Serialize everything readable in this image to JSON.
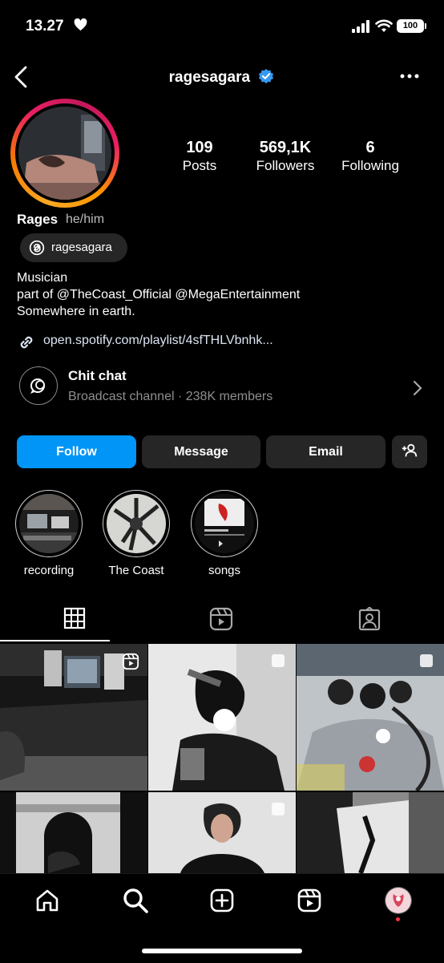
{
  "status_bar": {
    "time": "13.27",
    "battery": "100"
  },
  "header": {
    "username": "ragesagara"
  },
  "profile": {
    "stats": [
      {
        "value": "109",
        "label": "Posts"
      },
      {
        "value": "569,1K",
        "label": "Followers"
      },
      {
        "value": "6",
        "label": "Following"
      }
    ],
    "display_name": "Rages",
    "pronouns": "he/him",
    "threads_handle": "ragesagara",
    "bio": [
      "Musician",
      "part of @TheCoast_Official @MegaEntertainment",
      "Somewhere in earth."
    ],
    "link": "open.spotify.com/playlist/4sfTHLVbnhk..."
  },
  "channel": {
    "title": "Chit chat",
    "subtitle": "Broadcast channel · 238K members"
  },
  "actions": {
    "follow": "Follow",
    "message": "Message",
    "email": "Email"
  },
  "highlights": [
    {
      "label": "recording"
    },
    {
      "label": "The Coast"
    },
    {
      "label": "songs"
    }
  ],
  "colors": {
    "accent": "#0095f6",
    "verified": "#3897f0",
    "button_bg": "#262626",
    "secondary_text": "#8e8e8e"
  }
}
